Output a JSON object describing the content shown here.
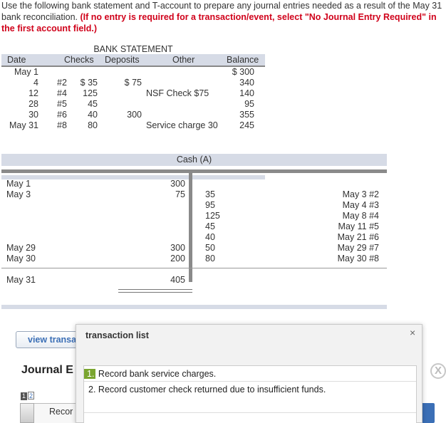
{
  "instructions": {
    "text": "Use the following bank statement and T-account to prepare any journal entries needed as a result of the May 31 bank reconciliation. ",
    "note": "(If no entry is required for a transaction/event, select \"No Journal Entry Required\" in the first account field.)"
  },
  "bank_statement": {
    "title": "BANK STATEMENT",
    "headers": {
      "date": "Date",
      "checks": "Checks",
      "deposits": "Deposits",
      "other": "Other",
      "balance": "Balance"
    },
    "rows": [
      {
        "date": "May  1",
        "check_no": "",
        "check_amt": "",
        "deposit": "",
        "other": "",
        "balance": "$ 300"
      },
      {
        "date": "4",
        "check_no": "#2",
        "check_amt": "$ 35",
        "deposit": "$ 75",
        "other": "",
        "balance": "340"
      },
      {
        "date": "12",
        "check_no": "#4",
        "check_amt": "125",
        "deposit": "",
        "other": "NSF Check $75",
        "balance": "140"
      },
      {
        "date": "28",
        "check_no": "#5",
        "check_amt": "45",
        "deposit": "",
        "other": "",
        "balance": "95"
      },
      {
        "date": "30",
        "check_no": "#6",
        "check_amt": "40",
        "deposit": "300",
        "other": "",
        "balance": "355"
      },
      {
        "date": "May 31",
        "check_no": "#8",
        "check_amt": "80",
        "deposit": "",
        "other": "Service charge 30",
        "balance": "245"
      }
    ]
  },
  "t_account": {
    "title": "Cash (A)",
    "left_labels": [
      "May 1",
      "May 3",
      "May 29",
      "May 30",
      "May 31"
    ],
    "debits": [
      "300",
      "75",
      "300",
      "200",
      "405"
    ],
    "credits": [
      "35",
      "95",
      "125",
      "45",
      "40",
      "50",
      "80"
    ],
    "right_labels": [
      "May 3 #2",
      "May 4 #3",
      "May 8 #4",
      "May 11 #5",
      "May 21 #6",
      "May 29 #7",
      "May 30 #8"
    ]
  },
  "page": {
    "view_button": "view transa",
    "journal_title": "Journal E",
    "pager": [
      "1",
      "2"
    ],
    "record_tab": "Recor",
    "close_symbol": "X"
  },
  "popup": {
    "title": "transaction list",
    "close": "×",
    "items": [
      {
        "num": "1.",
        "text": "Record bank service charges."
      },
      {
        "num": "2.",
        "text": "Record customer check returned due to insufficient funds."
      }
    ]
  },
  "colors": {
    "accent_red": "#d0021b",
    "header_band": "#d6dbe6",
    "highlight_green": "#7aa52f",
    "link_blue": "#3b6fb6"
  }
}
